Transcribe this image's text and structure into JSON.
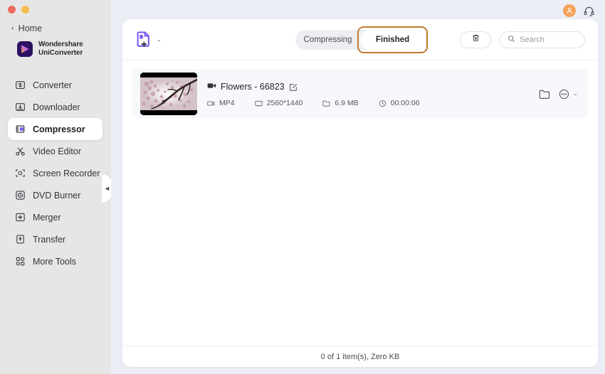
{
  "window": {
    "traffic_lights": [
      "close",
      "minimize"
    ]
  },
  "sidebar": {
    "home_label": "Home",
    "home_chevron": "‹",
    "brand": {
      "line1": "Wondershare",
      "line2": "UniConverter"
    },
    "items": [
      {
        "label": "Converter",
        "icon": "converter-icon",
        "active": false
      },
      {
        "label": "Downloader",
        "icon": "downloader-icon",
        "active": false
      },
      {
        "label": "Compressor",
        "icon": "compressor-icon",
        "active": true
      },
      {
        "label": "Video Editor",
        "icon": "scissors-icon",
        "active": false
      },
      {
        "label": "Screen Recorder",
        "icon": "screen-recorder-icon",
        "active": false
      },
      {
        "label": "DVD Burner",
        "icon": "disc-icon",
        "active": false
      },
      {
        "label": "Merger",
        "icon": "merger-icon",
        "active": false
      },
      {
        "label": "Transfer",
        "icon": "transfer-icon",
        "active": false
      },
      {
        "label": "More Tools",
        "icon": "grid-icon",
        "active": false
      }
    ],
    "collapse_chevron": "◄"
  },
  "topbar": {
    "avatar_icon": "user-avatar-icon",
    "avatar_color": "#f5a25a",
    "support_icon": "headset-icon"
  },
  "toolbar": {
    "add_file_icon": "add-file-icon",
    "add_file_dropdown": "⌄",
    "accent_color": "#7b61e8",
    "tabs": [
      {
        "label": "Compressing",
        "active": false,
        "highlighted": false
      },
      {
        "label": "Finished",
        "active": true,
        "highlighted": true
      }
    ],
    "highlight_color": "#c4792f",
    "trash_icon": "trash-icon",
    "search": {
      "icon": "search-icon",
      "placeholder": "Search",
      "value": ""
    }
  },
  "file_list": {
    "rows": [
      {
        "thumbnail_alt": "cherry-blossom-video-thumbnail",
        "title_icon": "video-camera-icon",
        "title": "Flowers - 66823",
        "edit_icon": "edit-pencil-icon",
        "specs": [
          {
            "icon": "format-icon",
            "value": "MP4"
          },
          {
            "icon": "resolution-icon",
            "value": "2560*1440"
          },
          {
            "icon": "filesize-icon",
            "value": "6.9 MB"
          },
          {
            "icon": "clock-icon",
            "value": "00:00:06"
          }
        ],
        "actions": {
          "folder_icon": "open-folder-icon",
          "more_icon": "more-options-icon",
          "more_chevron": "⌄"
        }
      }
    ]
  },
  "statusbar": {
    "text": "0 of 1 item(s), Zero KB"
  }
}
